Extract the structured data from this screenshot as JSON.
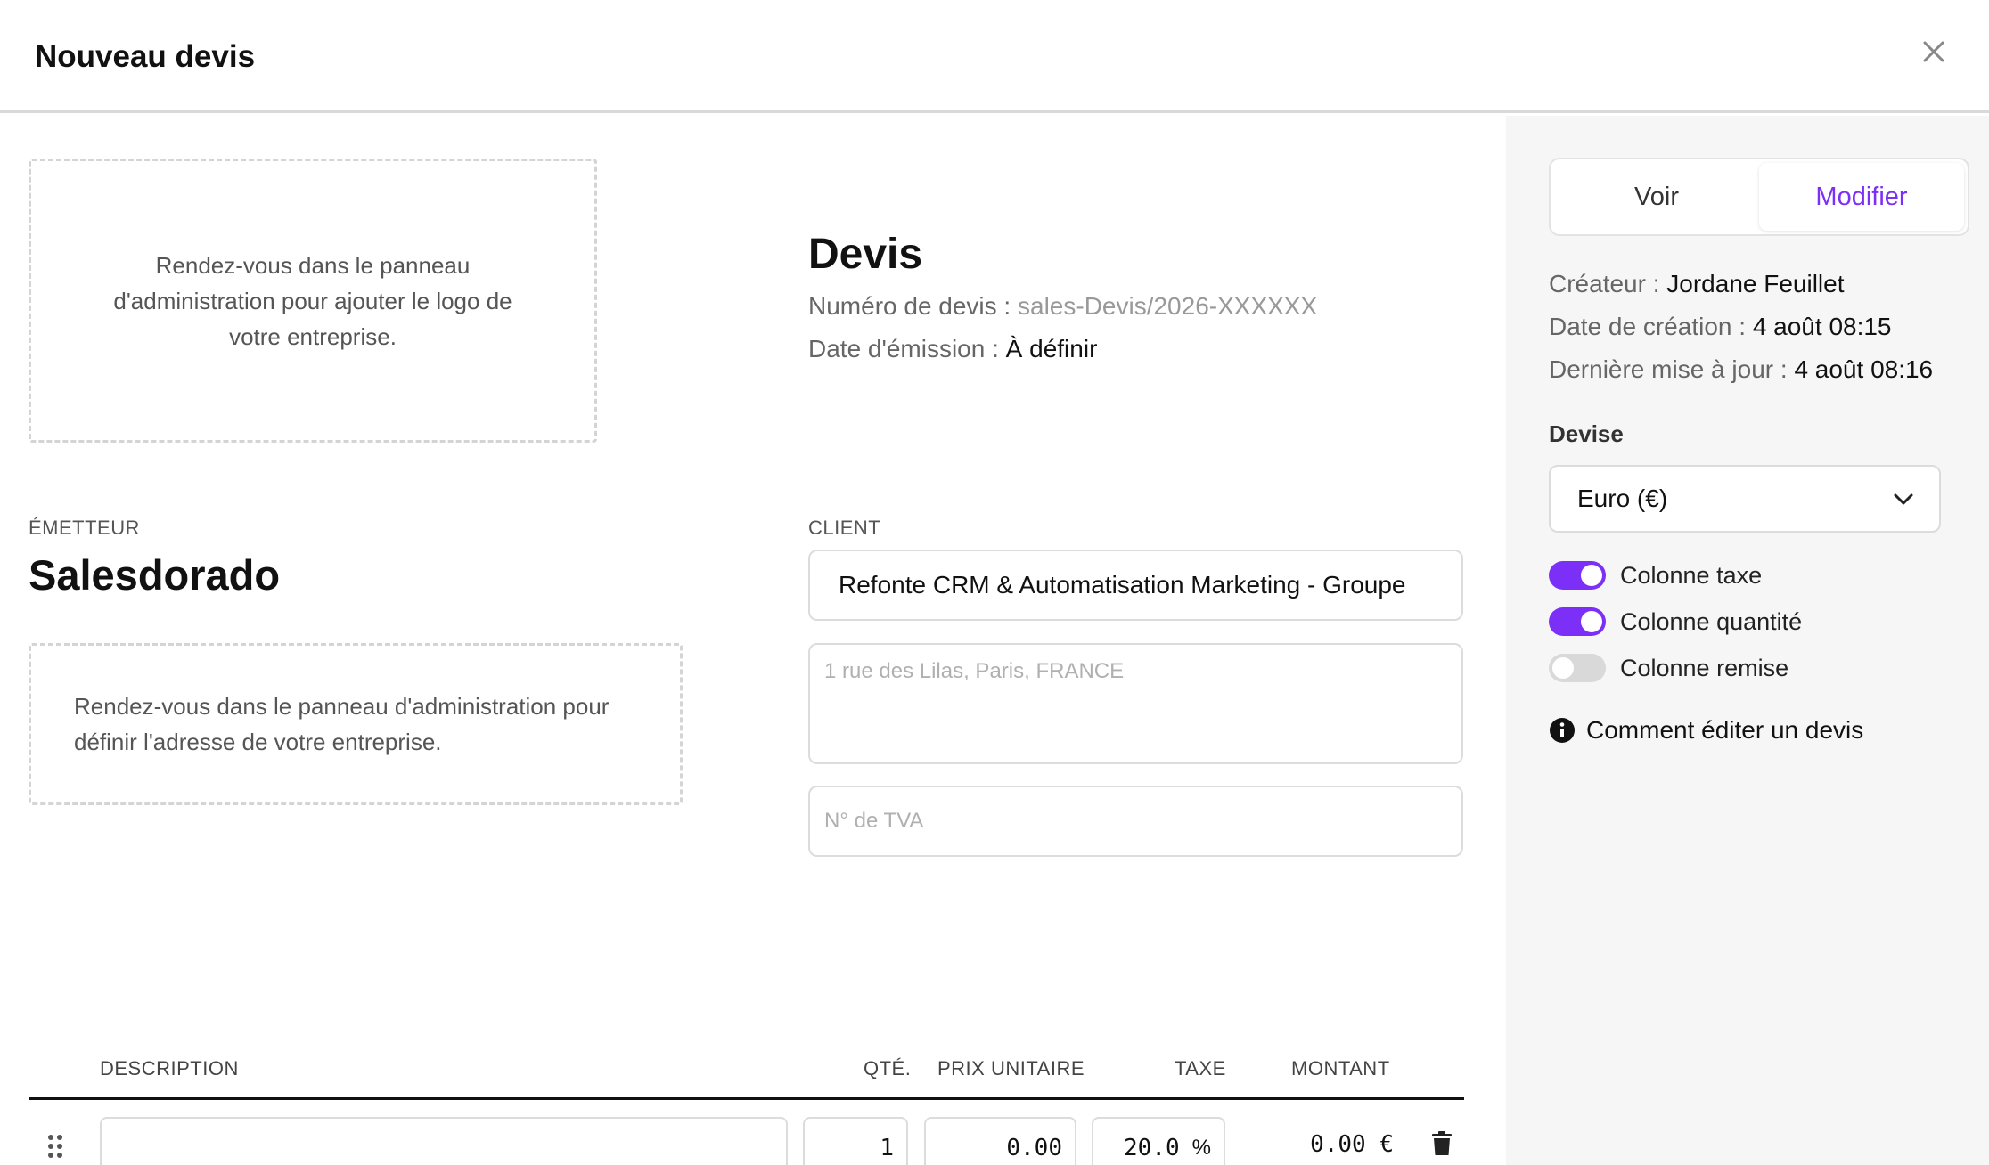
{
  "header": {
    "title": "Nouveau devis"
  },
  "logo_placeholder": "Rendez-vous dans le panneau d'administration pour ajouter le logo de votre entreprise.",
  "document": {
    "title": "Devis",
    "number_label": "Numéro de devis : ",
    "number_value": "sales-Devis/2026-XXXXXX",
    "date_label": "Date d'émission : ",
    "date_value": "À définir"
  },
  "issuer": {
    "label": "ÉMETTEUR",
    "name": "Salesdorado",
    "address_placeholder": "Rendez-vous dans le panneau d'administration pour définir l'adresse de votre entreprise."
  },
  "client": {
    "label": "CLIENT",
    "name_value": "Refonte CRM & Automatisation Marketing - Groupe",
    "address_placeholder": "1 rue des Lilas, Paris, FRANCE",
    "vat_placeholder": "N° de TVA"
  },
  "table": {
    "headers": {
      "description": "DESCRIPTION",
      "qty": "QTÉ.",
      "unit_price": "PRIX UNITAIRE",
      "tax": "TAXE",
      "amount": "MONTANT"
    },
    "rows": [
      {
        "description": "",
        "qty": "1",
        "unit_price": "0.00",
        "tax": "20.0",
        "tax_unit": "%",
        "amount": "0.00 €"
      }
    ]
  },
  "sidebar": {
    "tabs": [
      {
        "label": "Voir",
        "active": false
      },
      {
        "label": "Modifier",
        "active": true
      }
    ],
    "creator_label": "Créateur : ",
    "creator_value": "Jordane Feuillet",
    "created_label": "Date de création : ",
    "created_value": "4 août 08:15",
    "updated_label": "Dernière mise à jour : ",
    "updated_value": "4 août 08:16",
    "currency_label": "Devise",
    "currency_value": "Euro (€)",
    "toggles": [
      {
        "label": "Colonne taxe",
        "on": true
      },
      {
        "label": "Colonne quantité",
        "on": true
      },
      {
        "label": "Colonne remise",
        "on": false
      }
    ],
    "help_link": "Comment éditer un devis"
  },
  "colors": {
    "accent": "#7b2ff7",
    "sidebar_bg": "#f6f6f6",
    "border": "#dcdcdc"
  }
}
